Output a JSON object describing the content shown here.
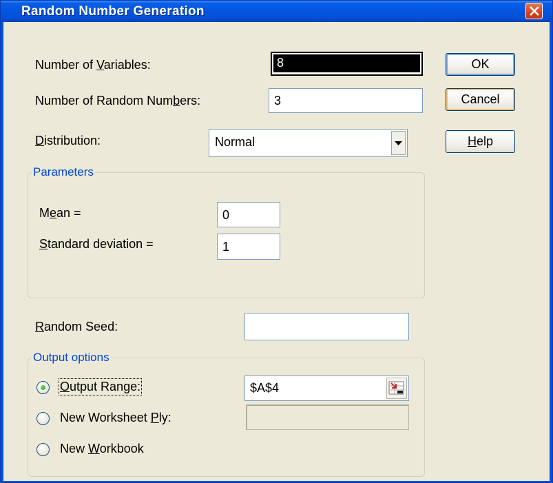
{
  "window": {
    "title": "Random Number Generation",
    "close_icon": "close-icon"
  },
  "fields": {
    "num_variables": {
      "label_pre": "Number of ",
      "label_key": "V",
      "label_post": "ariables:",
      "value": "8"
    },
    "num_random": {
      "label_pre": "Number of Random Num",
      "label_key": "b",
      "label_post": "ers:",
      "value": "3"
    },
    "distribution": {
      "label_pre": "",
      "label_key": "D",
      "label_post": "istribution:",
      "value": "Normal"
    }
  },
  "buttons": {
    "ok": "OK",
    "cancel": "Cancel",
    "help": {
      "key": "H",
      "rest": "elp"
    }
  },
  "parameters": {
    "title": "Parameters",
    "mean": {
      "label_pre": "M",
      "label_key": "e",
      "label_post": "an =",
      "value": "0"
    },
    "std": {
      "label_pre": "",
      "label_key": "S",
      "label_post": "tandard deviation =",
      "value": "1"
    }
  },
  "seed": {
    "label_pre": "",
    "label_key": "R",
    "label_post": "andom Seed:",
    "value": ""
  },
  "output": {
    "title": "Output options",
    "output_range": {
      "label_pre": "",
      "label_key": "O",
      "label_post": "utput Range:",
      "value": "$A$4",
      "selected": true
    },
    "new_ply": {
      "label_pre": "New Worksheet ",
      "label_key": "P",
      "label_post": "ly:",
      "value": ""
    },
    "new_workbook": {
      "label_pre": "New ",
      "label_key": "W",
      "label_post": "orkbook"
    }
  },
  "colors": {
    "title_bar": "#0354df",
    "group_title": "#0046d5",
    "dialog_bg": "#ece9d8"
  }
}
